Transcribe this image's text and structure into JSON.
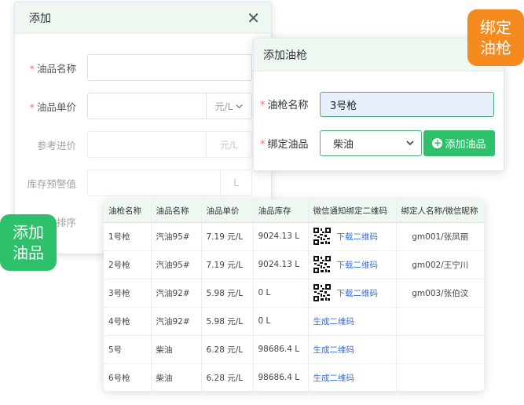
{
  "colors": {
    "accent_green": "#2ec06a",
    "badge_orange": "#f58a1f",
    "header_tint": "#eef8f0",
    "required_star": "#f56c6c",
    "link": "#3a6fd1"
  },
  "badges": {
    "bind_gun": "绑定油枪",
    "add_product": "添加油品"
  },
  "add_dialog": {
    "title": "添加",
    "close_icon": "close-icon",
    "fields": [
      {
        "label": "油品名称",
        "required": true
      },
      {
        "label": "油品单价",
        "required": true,
        "suffix": "元/L"
      },
      {
        "label": "参考进价",
        "required": false,
        "suffix": "元/L"
      },
      {
        "label": "库存预警值",
        "required": false,
        "suffix": "L"
      },
      {
        "label": "排序",
        "required": false
      }
    ]
  },
  "gun_dialog": {
    "title": "添加油枪",
    "gun_name_label": "油枪名称",
    "gun_name_value": "3号枪",
    "bind_label": "绑定油品",
    "bind_value": "柴油",
    "add_button": "添加油品",
    "required_mark": "*"
  },
  "table": {
    "headers": [
      "油枪名称",
      "油品名称",
      "油品单价",
      "油品库存",
      "微信通知绑定二维码",
      "绑定人名称/微信昵称"
    ],
    "rows": [
      {
        "gun": "1号枪",
        "product": "汽油95#",
        "price": "7.19 元/L",
        "stock": "9024.13 L",
        "has_qr": true,
        "action": "下载二维码",
        "bind": "gm001/张凤丽"
      },
      {
        "gun": "2号枪",
        "product": "汽油95#",
        "price": "7.19 元/L",
        "stock": "9024.13 L",
        "has_qr": true,
        "action": "下载二维码",
        "bind": "gm002/王宁川"
      },
      {
        "gun": "3号枪",
        "product": "汽油92#",
        "price": "5.98 元/L",
        "stock": "0 L",
        "has_qr": true,
        "action": "下载二维码",
        "bind": "gm003/张伯汶"
      },
      {
        "gun": "4号枪",
        "product": "汽油92#",
        "price": "5.98 元/L",
        "stock": "0 L",
        "has_qr": false,
        "action": "生成二维码",
        "bind": ""
      },
      {
        "gun": "5号",
        "product": "柴油",
        "price": "6.28 元/L",
        "stock": "98686.4 L",
        "has_qr": false,
        "action": "生成二维码",
        "bind": ""
      },
      {
        "gun": "6号枪",
        "product": "柴油",
        "price": "6.28 元/L",
        "stock": "98686.4 L",
        "has_qr": false,
        "action": "生成二维码",
        "bind": ""
      }
    ]
  }
}
